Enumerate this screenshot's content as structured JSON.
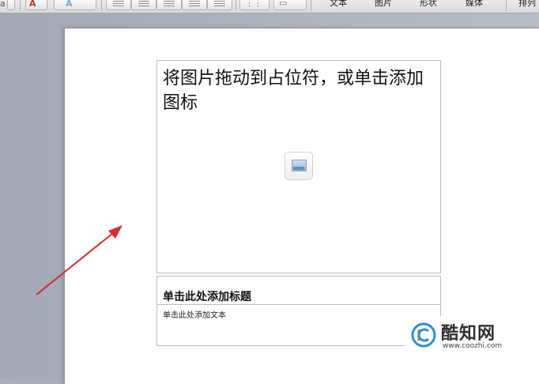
{
  "toolbar": {
    "font_fragment": "a",
    "ribbon_tabs": [
      "文本",
      "图片",
      "形状",
      "媒体",
      "排列"
    ]
  },
  "slide": {
    "image_placeholder": {
      "prompt": "将图片拖动到占位符，或单击添加图标",
      "icon": "image-insert-icon"
    },
    "title_placeholder": "单击此处添加标题",
    "body_placeholder": "单击此处添加文本"
  },
  "annotation": {
    "arrow_color": "#d32f2f"
  },
  "watermark": {
    "name": "酷知网",
    "url": "www.coozhi.com"
  }
}
